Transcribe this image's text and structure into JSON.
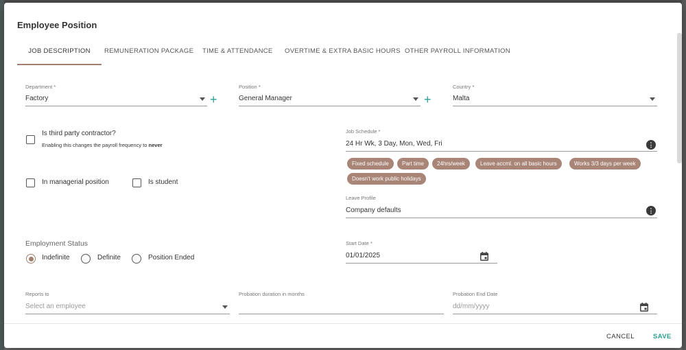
{
  "dialog": {
    "title": "Employee Position",
    "tabs": [
      {
        "label": "JOB DESCRIPTION"
      },
      {
        "label": "REMUNERATION PACKAGE"
      },
      {
        "label": "TIME & ATTENDANCE"
      },
      {
        "label": "OVERTIME & EXTRA BASIC HOURS"
      },
      {
        "label": "OTHER PAYROLL INFORMATION"
      }
    ],
    "active_tab": "JOB DESCRIPTION"
  },
  "department": {
    "label": "Department *",
    "value": "Factory"
  },
  "position": {
    "label": "Position *",
    "value": "General Manager"
  },
  "country": {
    "label": "Country *",
    "value": "Malta"
  },
  "third_party": {
    "label": "Is third party contractor?",
    "hint_prefix": "Enabling this changes the payroll frequency to",
    "hint_emphasis": "never",
    "checked": false
  },
  "managerial": {
    "label": "In managerial position",
    "checked": false
  },
  "student": {
    "label": "Is student",
    "checked": false
  },
  "job_schedule": {
    "label": "Job Schedule *",
    "value": "24 Hr Wk, 3 Day, Mon, Wed, Fri",
    "info_icon": "info-icon",
    "chips": [
      "Fixed schedule",
      "Part time",
      "24hrs/week",
      "Leave accml. on all basic hours",
      "Works 3/3 days per week",
      "Doesn't work public holidays"
    ]
  },
  "leave_profile": {
    "label": "Leave Profile",
    "value": "Company defaults",
    "info_icon": "info-icon"
  },
  "employment_status": {
    "label": "Employment Status",
    "options": [
      "Indefinite",
      "Definite",
      "Position Ended"
    ],
    "selected": "Indefinite"
  },
  "start_date": {
    "label": "Start Date *",
    "value": "01/01/2025",
    "icon": "calendar-icon"
  },
  "reports_to": {
    "label": "Reports to",
    "placeholder": "Select an employee"
  },
  "probation_duration": {
    "label": "Probation duration in months",
    "value": ""
  },
  "probation_end": {
    "label": "Probation End Date",
    "placeholder": "dd/mm/yyyy",
    "icon": "calendar-icon"
  },
  "footer": {
    "cancel": "CANCEL",
    "save": "SAVE"
  },
  "colors": {
    "accent": "#a07f6e",
    "chip": "#a88576",
    "plus": "#2a9d8f",
    "save": "#2a9d8f"
  }
}
